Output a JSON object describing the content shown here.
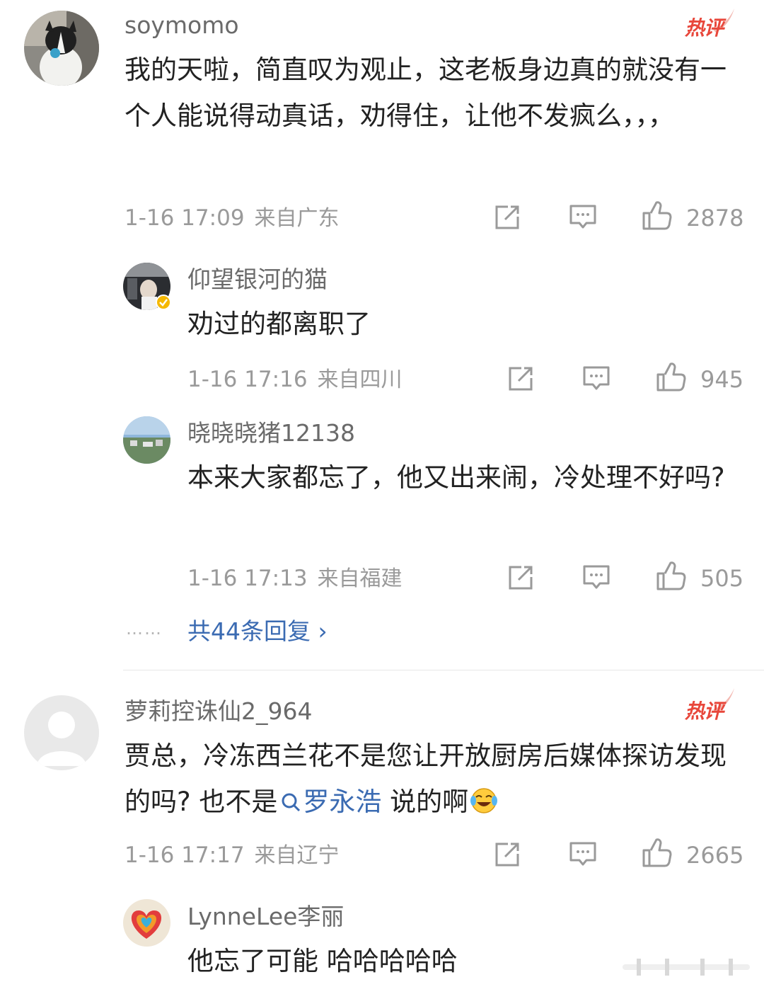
{
  "comments": [
    {
      "username": "soymomo",
      "badge": "热评",
      "text": "我的天啦，简直叹为观止，这老板身边真的就没有一个人能说得动真话，劝得住，让他不发疯么，，，",
      "time": "1-16 17:09",
      "location": "来自广东",
      "likes": "2878",
      "replies": [
        {
          "username": "仰望银河的猫",
          "verified": true,
          "text": "劝过的都离职了",
          "time": "1-16 17:16",
          "location": "来自四川",
          "likes": "945"
        },
        {
          "username": "晓晓晓猪12138",
          "text": "本来大家都忘了，他又出来闹，冷处理不好吗?",
          "time": "1-16 17:13",
          "location": "来自福建",
          "likes": "505"
        }
      ],
      "more_dots": "……",
      "more_replies_label": "共44条回复 ›"
    },
    {
      "username": "萝莉控诛仙2_964",
      "badge": "热评",
      "text_before": "贾总，冷冻西兰花不是您让开放厨房后媒体探访发现的吗? 也不是",
      "link_text": "罗永浩",
      "text_after": " 说的啊",
      "emoji": "cry-laugh-emoji",
      "time": "1-16 17:17",
      "location": "来自辽宁",
      "likes": "2665",
      "replies": [
        {
          "username": "LynneLee李丽",
          "text": "他忘了可能 哈哈哈哈哈"
        }
      ]
    }
  ],
  "icons": {
    "share": "share-icon",
    "comment": "comment-icon",
    "like": "thumbs-up-icon",
    "search": "search-icon"
  },
  "colors": {
    "hot_badge": "#e8473b",
    "link": "#3b6bb2",
    "meta": "#9a9a9a"
  }
}
